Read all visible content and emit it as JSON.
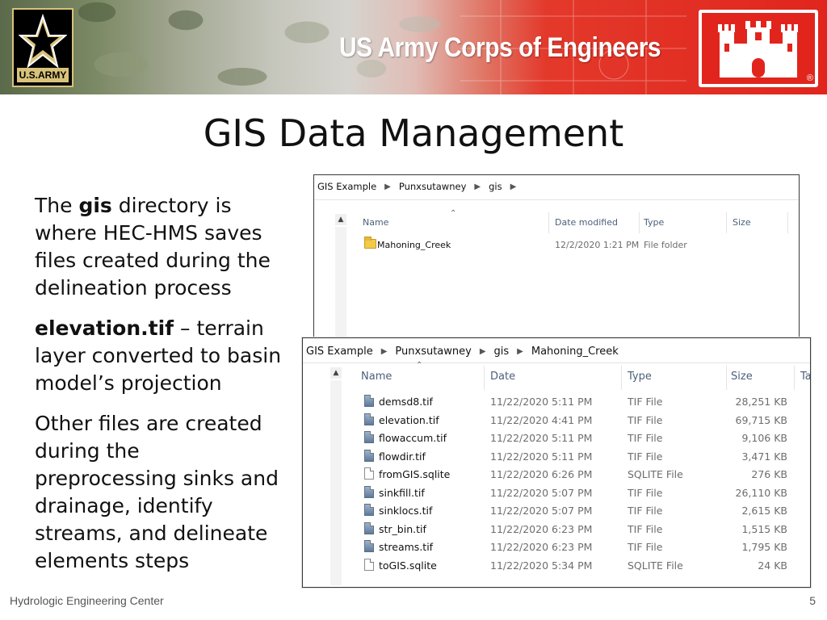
{
  "banner": {
    "org_title": "US Army Corps of Engineers",
    "army_logo_text": "U.S.ARMY",
    "registered_mark": "®"
  },
  "slide": {
    "title": "GIS Data Management",
    "paragraph1": {
      "pre": "The ",
      "bold": "gis",
      "post": " directory is where HEC-HMS saves files created during the delineation process"
    },
    "paragraph2": {
      "bold": "elevation.tif",
      "post": " – terrain layer converted to basin model’s projection"
    },
    "paragraph3": "Other files are created during the preprocessing sinks and drainage, identify streams, and delineate elements steps"
  },
  "explorer1": {
    "breadcrumb": [
      "GIS Example",
      "Punxsutawney",
      "gis"
    ],
    "columns": [
      "Name",
      "Date modified",
      "Type",
      "Size"
    ],
    "rows": [
      {
        "name": "Mahoning_Creek",
        "date": "12/2/2020 1:21 PM",
        "type": "File folder",
        "size": "",
        "icon": "folder-icon"
      }
    ]
  },
  "explorer2": {
    "breadcrumb": [
      "GIS Example",
      "Punxsutawney",
      "gis",
      "Mahoning_Creek"
    ],
    "columns": [
      "Name",
      "Date",
      "Type",
      "Size",
      "Ta"
    ],
    "rows": [
      {
        "name": "demsd8.tif",
        "date": "11/22/2020 5:11 PM",
        "type": "TIF File",
        "size": "28,251 KB",
        "icon": "image-file-icon"
      },
      {
        "name": "elevation.tif",
        "date": "11/22/2020 4:41 PM",
        "type": "TIF File",
        "size": "69,715 KB",
        "icon": "image-file-icon"
      },
      {
        "name": "flowaccum.tif",
        "date": "11/22/2020 5:11 PM",
        "type": "TIF File",
        "size": "9,106 KB",
        "icon": "image-file-icon"
      },
      {
        "name": "flowdir.tif",
        "date": "11/22/2020 5:11 PM",
        "type": "TIF File",
        "size": "3,471 KB",
        "icon": "image-file-icon"
      },
      {
        "name": "fromGIS.sqlite",
        "date": "11/22/2020 6:26 PM",
        "type": "SQLITE File",
        "size": "276 KB",
        "icon": "document-file-icon"
      },
      {
        "name": "sinkfill.tif",
        "date": "11/22/2020 5:07 PM",
        "type": "TIF File",
        "size": "26,110 KB",
        "icon": "image-file-icon"
      },
      {
        "name": "sinklocs.tif",
        "date": "11/22/2020 5:07 PM",
        "type": "TIF File",
        "size": "2,615 KB",
        "icon": "image-file-icon"
      },
      {
        "name": "str_bin.tif",
        "date": "11/22/2020 6:23 PM",
        "type": "TIF File",
        "size": "1,515 KB",
        "icon": "image-file-icon"
      },
      {
        "name": "streams.tif",
        "date": "11/22/2020 6:23 PM",
        "type": "TIF File",
        "size": "1,795 KB",
        "icon": "image-file-icon"
      },
      {
        "name": "toGIS.sqlite",
        "date": "11/22/2020 5:34 PM",
        "type": "SQLITE File",
        "size": "24 KB",
        "icon": "document-file-icon"
      }
    ]
  },
  "footer": {
    "org": "Hydrologic Engineering Center",
    "page": "5"
  }
}
